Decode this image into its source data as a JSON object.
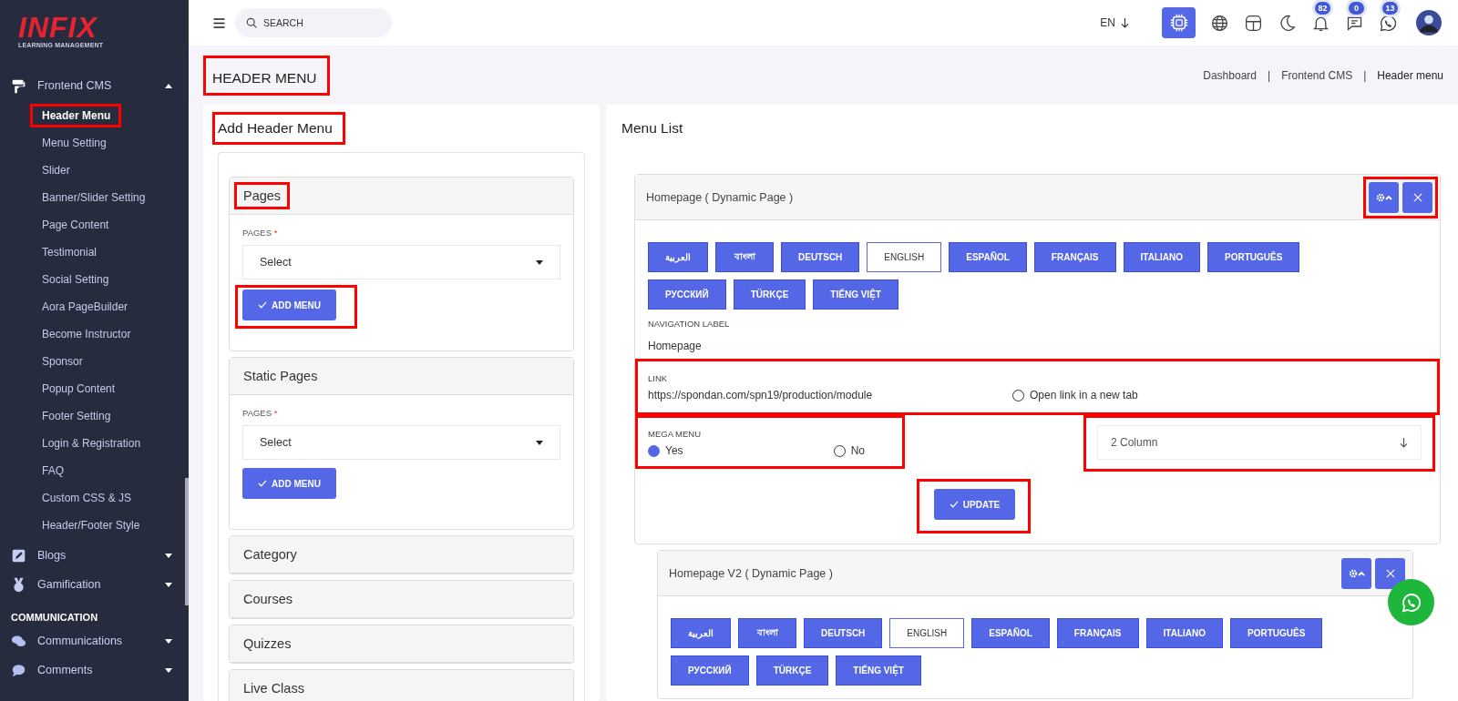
{
  "logo": {
    "name": "INFIX",
    "tagline": "LEARNING MANAGEMENT"
  },
  "sidebar": {
    "items": [
      {
        "kind": "group",
        "label": "Frontend CMS",
        "expanded": true,
        "children": [
          {
            "label": "Header Menu",
            "selected": true,
            "highlighted": true
          },
          {
            "label": "Menu Setting",
            "selected": false,
            "highlighted": false
          },
          {
            "label": "Slider",
            "selected": false,
            "highlighted": false
          },
          {
            "label": "Banner/Slider Setting",
            "selected": false,
            "highlighted": false
          },
          {
            "label": "Page Content",
            "selected": false,
            "highlighted": false
          },
          {
            "label": "Testimonial",
            "selected": false,
            "highlighted": false
          },
          {
            "label": "Social Setting",
            "selected": false,
            "highlighted": false
          },
          {
            "label": "Aora PageBuilder",
            "selected": false,
            "highlighted": false
          },
          {
            "label": "Become Instructor",
            "selected": false,
            "highlighted": false
          },
          {
            "label": "Sponsor",
            "selected": false,
            "highlighted": false
          },
          {
            "label": "Popup Content",
            "selected": false,
            "highlighted": false
          },
          {
            "label": "Footer Setting",
            "selected": false,
            "highlighted": false
          },
          {
            "label": "Login & Registration",
            "selected": false,
            "highlighted": false
          },
          {
            "label": "FAQ",
            "selected": false,
            "highlighted": false
          },
          {
            "label": "Custom CSS & JS",
            "selected": false,
            "highlighted": false
          },
          {
            "label": "Header/Footer Style",
            "selected": false,
            "highlighted": false
          }
        ]
      },
      {
        "kind": "group",
        "label": "Blogs",
        "expanded": false
      },
      {
        "kind": "group",
        "label": "Gamification",
        "expanded": false
      },
      {
        "kind": "heading",
        "label": "COMMUNICATION"
      },
      {
        "kind": "group",
        "label": "Communications",
        "expanded": false
      },
      {
        "kind": "group",
        "label": "Comments",
        "expanded": false
      }
    ]
  },
  "topbar": {
    "search": {
      "placeholder": "SEARCH"
    },
    "language": "EN",
    "notifications": "82",
    "messages": "0",
    "chats": "13"
  },
  "page": {
    "title": "HEADER MENU",
    "title_highlighted": true,
    "breadcrumbs": [
      "Dashboard",
      "Frontend CMS",
      "Header menu"
    ],
    "separator": "|"
  },
  "add_panel": {
    "title": "Add Header Menu",
    "title_highlighted": true,
    "sections": [
      {
        "title": "Pages",
        "expanded": true,
        "highlighted": true,
        "field_label": "PAGES",
        "required_mark": "*",
        "select_value": "Select",
        "button": "ADD MENU",
        "button_highlighted": true
      },
      {
        "title": "Static Pages",
        "expanded": true,
        "highlighted": false,
        "field_label": "PAGES",
        "required_mark": "*",
        "select_value": "Select",
        "button": "ADD MENU",
        "button_highlighted": false
      },
      {
        "title": "Category",
        "expanded": false,
        "highlighted": false
      },
      {
        "title": "Courses",
        "expanded": false,
        "highlighted": false
      },
      {
        "title": "Quizzes",
        "expanded": false,
        "highlighted": false
      },
      {
        "title": "Live Class",
        "expanded": false,
        "highlighted": false
      }
    ]
  },
  "menu_list": {
    "title": "Menu List",
    "items": [
      {
        "title": "Homepage ( Dynamic Page )",
        "actions_highlighted": true,
        "languages": [
          {
            "label": "العربية",
            "selected": false
          },
          {
            "label": "বাংলা",
            "selected": false
          },
          {
            "label": "DEUTSCH",
            "selected": false
          },
          {
            "label": "ENGLISH",
            "selected": true
          },
          {
            "label": "ESPAÑOL",
            "selected": false
          },
          {
            "label": "FRANÇAIS",
            "selected": false
          },
          {
            "label": "ITALIANO",
            "selected": false
          },
          {
            "label": "PORTUGUÊS",
            "selected": false
          },
          {
            "label": "РУССКИЙ",
            "selected": false
          },
          {
            "label": "TÜRKÇE",
            "selected": false
          },
          {
            "label": "TIẾNG VIỆT",
            "selected": false
          }
        ],
        "nav_caption": "NAVIGATION LABEL",
        "nav_label": "Homepage",
        "link_caption": "LINK",
        "link": "https://spondan.com/spn19/production/module",
        "link_highlighted": true,
        "new_tab_label": "Open link in a new tab",
        "new_tab": false,
        "mega_caption": "MEGA MENU",
        "mega_highlighted": true,
        "mega_options": [
          {
            "label": "Yes",
            "selected": true
          },
          {
            "label": "No",
            "selected": false
          }
        ],
        "column_select": "2 Column",
        "column_highlighted": true,
        "update": "UPDATE",
        "update_highlighted": true
      },
      {
        "title": "Homepage V2 ( Dynamic Page )",
        "actions_highlighted": false,
        "languages": [
          {
            "label": "العربية",
            "selected": false
          },
          {
            "label": "বাংলা",
            "selected": false
          },
          {
            "label": "DEUTSCH",
            "selected": false
          },
          {
            "label": "ENGLISH",
            "selected": true
          },
          {
            "label": "ESPAÑOL",
            "selected": false
          },
          {
            "label": "FRANÇAIS",
            "selected": false
          },
          {
            "label": "ITALIANO",
            "selected": false
          },
          {
            "label": "PORTUGUÊS",
            "selected": false
          },
          {
            "label": "РУССКИЙ",
            "selected": false
          },
          {
            "label": "TÜRKÇE",
            "selected": false
          },
          {
            "label": "TIẾNG VIỆT",
            "selected": false
          }
        ]
      }
    ]
  }
}
